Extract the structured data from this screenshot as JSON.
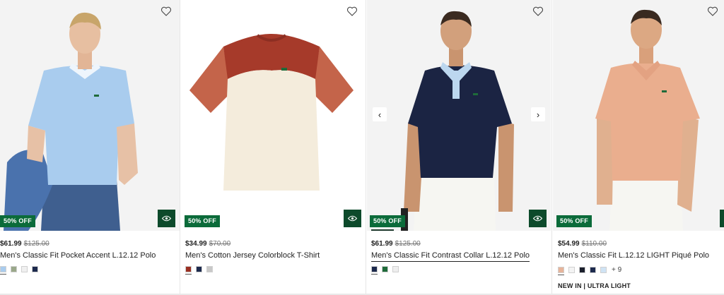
{
  "products": [
    {
      "price": "$61.99",
      "was_price": "$125.00",
      "badge": "50% OFF",
      "name": "Men's Classic Fit Pocket Accent L.12.12 Polo",
      "swatch_colors": [
        "#a9ccee",
        "#9aa88a",
        "#f0f0f0",
        "#1d2a4d"
      ],
      "wishlist_icon": "heart-outline-icon",
      "quick_view_icon": "eye-icon"
    },
    {
      "price": "$34.99",
      "was_price": "$70.00",
      "badge": "50% OFF",
      "name": "Men's Cotton Jersey Colorblock T-Shirt",
      "swatch_colors": [
        "#9a2f22",
        "#1d2a4d",
        "#c8c8c8"
      ],
      "wishlist_icon": "heart-outline-icon",
      "quick_view_icon": "eye-icon"
    },
    {
      "price": "$61.99",
      "was_price": "$125.00",
      "badge": "50% OFF",
      "name": "Men's Classic Fit Contrast Collar L.12.12 Polo",
      "swatch_colors": [
        "#1d2a4d",
        "#1f6b3a",
        "#eeeeee"
      ],
      "wishlist_icon": "heart-outline-icon",
      "quick_view_icon": "eye-icon",
      "carousel_prev": "‹",
      "carousel_next": "›"
    },
    {
      "price": "$54.99",
      "was_price": "$110.00",
      "badge": "50% OFF",
      "name": "Men's Classic Fit L.12.12 LIGHT Piqué Polo",
      "swatch_colors": [
        "#e7b49a",
        "#f3f3f3",
        "#1a1f2c",
        "#1d2a4d",
        "#cfe3f4"
      ],
      "more_colors": "+ 9",
      "tagline": "NEW IN | ULTRA LIGHT",
      "wishlist_icon": "heart-outline-icon"
    }
  ],
  "colors": {
    "badge_green": "#0b6b3a",
    "quick_view_green": "#0d4a2b"
  }
}
